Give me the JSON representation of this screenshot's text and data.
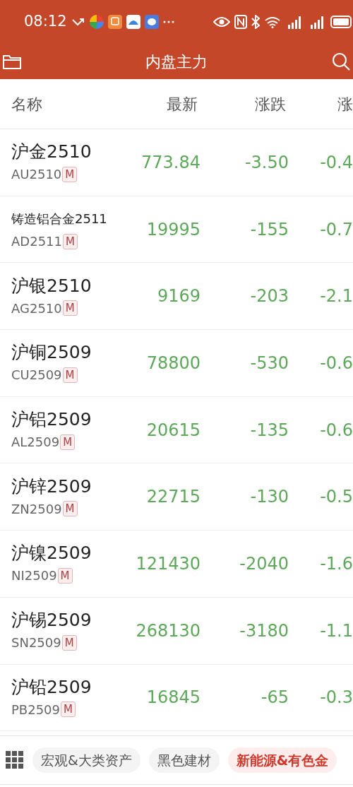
{
  "status_bar": {
    "time": "08:12"
  },
  "header": {
    "title": "内盘主力"
  },
  "columns": [
    "名称",
    "最新",
    "涨跌",
    "涨"
  ],
  "rows": [
    {
      "name": "沪金2510",
      "code": "AU2510",
      "badge": "M",
      "last": "773.84",
      "change": "-3.50",
      "pct": "-0.4"
    },
    {
      "name": "铸造铝合金2511",
      "code": "AD2511",
      "badge": "M",
      "last": "19995",
      "change": "-155",
      "pct": "-0.7"
    },
    {
      "name": "沪银2510",
      "code": "AG2510",
      "badge": "M",
      "last": "9169",
      "change": "-203",
      "pct": "-2.1"
    },
    {
      "name": "沪铜2509",
      "code": "CU2509",
      "badge": "M",
      "last": "78800",
      "change": "-530",
      "pct": "-0.6"
    },
    {
      "name": "沪铝2509",
      "code": "AL2509",
      "badge": "M",
      "last": "20615",
      "change": "-135",
      "pct": "-0.6"
    },
    {
      "name": "沪锌2509",
      "code": "ZN2509",
      "badge": "M",
      "last": "22715",
      "change": "-130",
      "pct": "-0.5"
    },
    {
      "name": "沪镍2509",
      "code": "NI2509",
      "badge": "M",
      "last": "121430",
      "change": "-2040",
      "pct": "-1.6"
    },
    {
      "name": "沪锡2509",
      "code": "SN2509",
      "badge": "M",
      "last": "268130",
      "change": "-3180",
      "pct": "-1.1"
    },
    {
      "name": "沪铅2509",
      "code": "PB2509",
      "badge": "M",
      "last": "16845",
      "change": "-65",
      "pct": "-0.3"
    }
  ],
  "category_tabs": [
    {
      "label": "宏观&大类资产",
      "selected": false
    },
    {
      "label": "黑色建材",
      "selected": false
    },
    {
      "label": "新能源&有色金",
      "selected": true
    }
  ]
}
